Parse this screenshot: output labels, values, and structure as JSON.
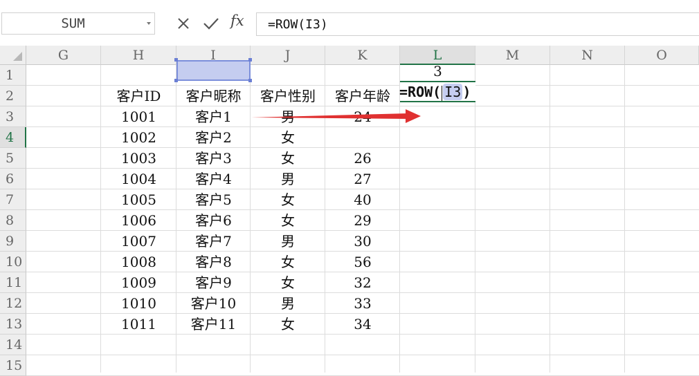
{
  "formula_bar": {
    "name_box": "SUM",
    "cancel_icon": "close-icon",
    "enter_icon": "check-icon",
    "fx_label": "fx",
    "formula": "=ROW(I3)"
  },
  "columns": [
    "G",
    "H",
    "I",
    "J",
    "K",
    "L",
    "M",
    "N",
    "O"
  ],
  "rows": [
    "1",
    "2",
    "3",
    "4",
    "5",
    "6",
    "7",
    "8",
    "9",
    "10",
    "11",
    "12",
    "13",
    "14",
    "15"
  ],
  "headers": {
    "h": "客户ID",
    "i": "客户昵称",
    "j": "客户性别",
    "k": "客户年龄"
  },
  "records": [
    {
      "id": "1001",
      "name": "客户1",
      "gender": "男",
      "age": "24"
    },
    {
      "id": "1002",
      "name": "客户2",
      "gender": "女",
      "age": ""
    },
    {
      "id": "1003",
      "name": "客户3",
      "gender": "女",
      "age": "26"
    },
    {
      "id": "1004",
      "name": "客户4",
      "gender": "男",
      "age": "27"
    },
    {
      "id": "1005",
      "name": "客户5",
      "gender": "女",
      "age": "40"
    },
    {
      "id": "1006",
      "name": "客户6",
      "gender": "女",
      "age": "29"
    },
    {
      "id": "1007",
      "name": "客户7",
      "gender": "男",
      "age": "30"
    },
    {
      "id": "1008",
      "name": "客户8",
      "gender": "女",
      "age": "56"
    },
    {
      "id": "1009",
      "name": "客户9",
      "gender": "女",
      "age": "32"
    },
    {
      "id": "1010",
      "name": "客户10",
      "gender": "男",
      "age": "33"
    },
    {
      "id": "1011",
      "name": "客户11",
      "gender": "女",
      "age": "34"
    }
  ],
  "l3_result": "3",
  "editing": {
    "prefix": "=ROW(",
    "ref": "I3",
    "suffix": ")"
  },
  "colors": {
    "selected_fill": "#c5cdf0",
    "active_green": "#217346",
    "arrow_red": "#e03131"
  }
}
